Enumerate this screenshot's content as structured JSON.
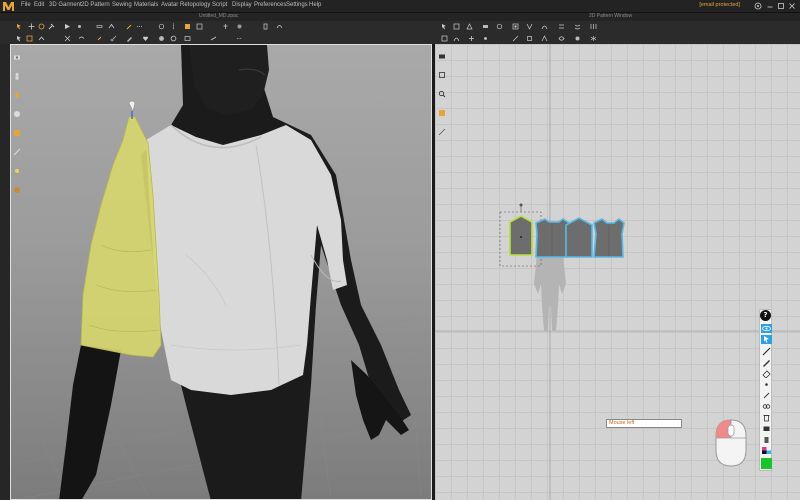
{
  "menu": {
    "items": [
      "File",
      "Edit",
      "3D Garment",
      "2D Pattern",
      "Sewing",
      "Materials",
      "Avatar",
      "Retopology",
      "Script",
      "Display",
      "Preferences",
      "Settings",
      "Help"
    ],
    "user": "[email protected]"
  },
  "windows": {
    "left_title": "Untitled_MD.zpac",
    "right_title": "2D Pattern Window"
  },
  "pattern_window": {
    "mouse_hint": "Mouse left",
    "info_button": "?"
  },
  "colors": {
    "accent": "#e8a43a",
    "sleeve_highlight": "#d6d66e",
    "pattern_fill": "#6d6d6d",
    "pattern_outline_selected": "#b6e23b",
    "pattern_outline": "#57b9e8",
    "viewport_border": "#e0e0e0"
  },
  "icons": {
    "logo": "md-logo-icon",
    "mouse": "mouse-icon"
  }
}
